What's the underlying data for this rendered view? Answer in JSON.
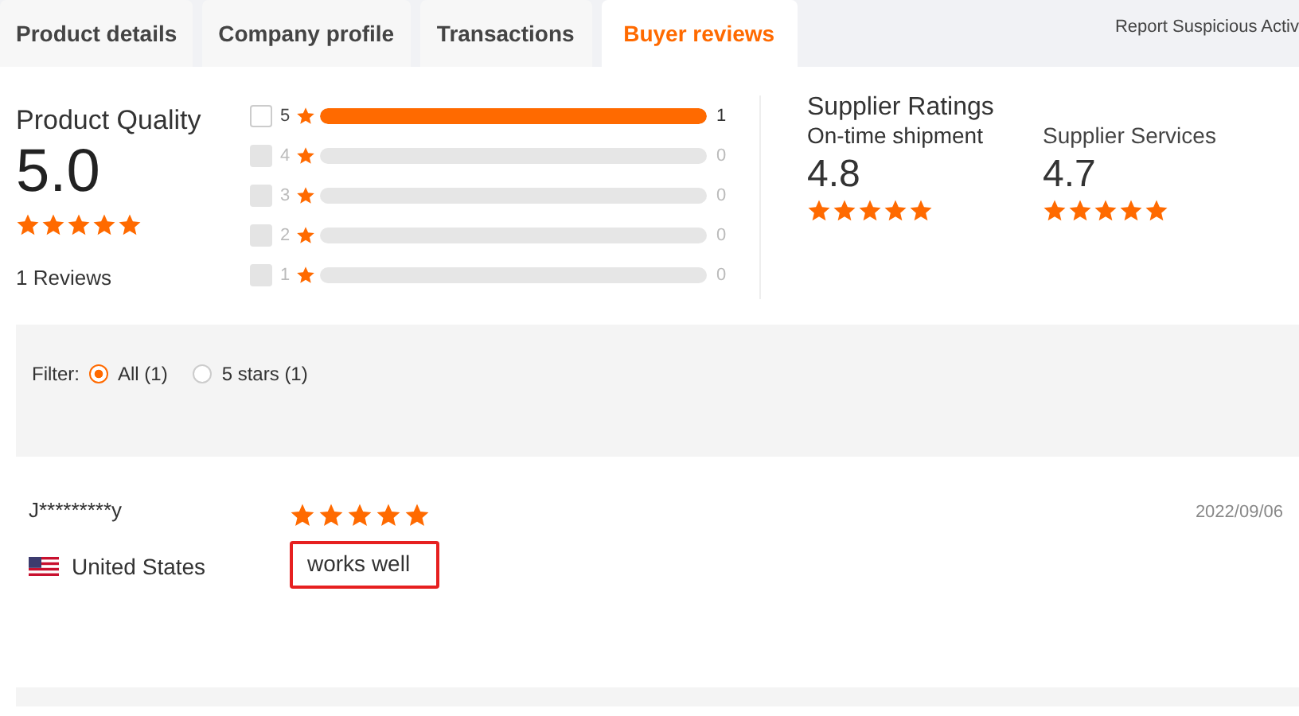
{
  "tabs": [
    {
      "label": "Product details",
      "selected": false
    },
    {
      "label": "Company profile",
      "selected": false
    },
    {
      "label": "Transactions",
      "selected": false
    },
    {
      "label": "Buyer reviews",
      "selected": true
    }
  ],
  "report_link": "Report Suspicious Activ",
  "product_quality": {
    "title": "Product Quality",
    "score": "5.0",
    "stars": 5,
    "reviews": "1 Reviews"
  },
  "histogram": [
    {
      "label": "5",
      "checked": false,
      "disabled": false,
      "level": 1,
      "count": "1"
    },
    {
      "label": "4",
      "checked": false,
      "disabled": true,
      "count": "0"
    },
    {
      "label": "3",
      "checked": false,
      "disabled": true,
      "count": "0"
    },
    {
      "label": "2",
      "checked": false,
      "disabled": true,
      "count": "0"
    },
    {
      "label": "1",
      "checked": false,
      "disabled": true,
      "count": "0"
    }
  ],
  "supplier_ratings": {
    "title": "Supplier Ratings",
    "items": [
      {
        "label": "On-time shipment",
        "score": "4.8",
        "stars": 5
      },
      {
        "label": "Supplier Services",
        "score": "4.7",
        "stars": 5
      }
    ]
  },
  "filter": {
    "label": "Filter:",
    "options": [
      {
        "label": "All (1)",
        "selected": true
      },
      {
        "label": "5 stars (1)",
        "selected": false
      }
    ]
  },
  "reviews": [
    {
      "user": "J*********y",
      "country": "United States",
      "stars": 5,
      "date": "2022/09/06",
      "text": "works well",
      "highlighted": true
    }
  ]
}
